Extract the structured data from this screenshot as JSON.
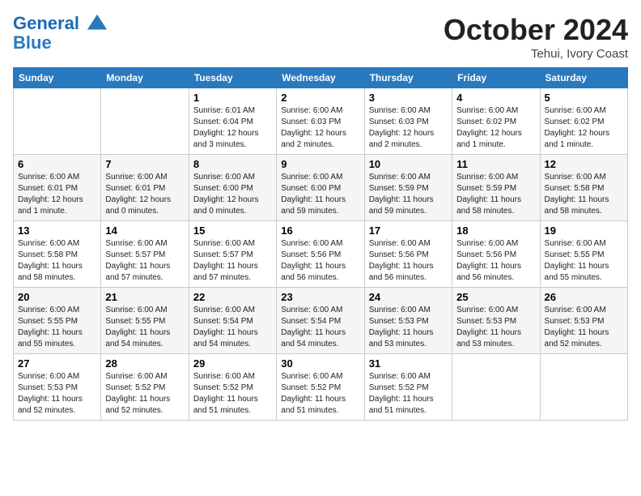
{
  "header": {
    "logo_line1": "General",
    "logo_line2": "Blue",
    "month": "October 2024",
    "location": "Tehui, Ivory Coast"
  },
  "weekdays": [
    "Sunday",
    "Monday",
    "Tuesday",
    "Wednesday",
    "Thursday",
    "Friday",
    "Saturday"
  ],
  "weeks": [
    [
      {
        "day": "",
        "info": ""
      },
      {
        "day": "",
        "info": ""
      },
      {
        "day": "1",
        "info": "Sunrise: 6:01 AM\nSunset: 6:04 PM\nDaylight: 12 hours and 3 minutes."
      },
      {
        "day": "2",
        "info": "Sunrise: 6:00 AM\nSunset: 6:03 PM\nDaylight: 12 hours and 2 minutes."
      },
      {
        "day": "3",
        "info": "Sunrise: 6:00 AM\nSunset: 6:03 PM\nDaylight: 12 hours and 2 minutes."
      },
      {
        "day": "4",
        "info": "Sunrise: 6:00 AM\nSunset: 6:02 PM\nDaylight: 12 hours and 1 minute."
      },
      {
        "day": "5",
        "info": "Sunrise: 6:00 AM\nSunset: 6:02 PM\nDaylight: 12 hours and 1 minute."
      }
    ],
    [
      {
        "day": "6",
        "info": "Sunrise: 6:00 AM\nSunset: 6:01 PM\nDaylight: 12 hours and 1 minute."
      },
      {
        "day": "7",
        "info": "Sunrise: 6:00 AM\nSunset: 6:01 PM\nDaylight: 12 hours and 0 minutes."
      },
      {
        "day": "8",
        "info": "Sunrise: 6:00 AM\nSunset: 6:00 PM\nDaylight: 12 hours and 0 minutes."
      },
      {
        "day": "9",
        "info": "Sunrise: 6:00 AM\nSunset: 6:00 PM\nDaylight: 11 hours and 59 minutes."
      },
      {
        "day": "10",
        "info": "Sunrise: 6:00 AM\nSunset: 5:59 PM\nDaylight: 11 hours and 59 minutes."
      },
      {
        "day": "11",
        "info": "Sunrise: 6:00 AM\nSunset: 5:59 PM\nDaylight: 11 hours and 58 minutes."
      },
      {
        "day": "12",
        "info": "Sunrise: 6:00 AM\nSunset: 5:58 PM\nDaylight: 11 hours and 58 minutes."
      }
    ],
    [
      {
        "day": "13",
        "info": "Sunrise: 6:00 AM\nSunset: 5:58 PM\nDaylight: 11 hours and 58 minutes."
      },
      {
        "day": "14",
        "info": "Sunrise: 6:00 AM\nSunset: 5:57 PM\nDaylight: 11 hours and 57 minutes."
      },
      {
        "day": "15",
        "info": "Sunrise: 6:00 AM\nSunset: 5:57 PM\nDaylight: 11 hours and 57 minutes."
      },
      {
        "day": "16",
        "info": "Sunrise: 6:00 AM\nSunset: 5:56 PM\nDaylight: 11 hours and 56 minutes."
      },
      {
        "day": "17",
        "info": "Sunrise: 6:00 AM\nSunset: 5:56 PM\nDaylight: 11 hours and 56 minutes."
      },
      {
        "day": "18",
        "info": "Sunrise: 6:00 AM\nSunset: 5:56 PM\nDaylight: 11 hours and 56 minutes."
      },
      {
        "day": "19",
        "info": "Sunrise: 6:00 AM\nSunset: 5:55 PM\nDaylight: 11 hours and 55 minutes."
      }
    ],
    [
      {
        "day": "20",
        "info": "Sunrise: 6:00 AM\nSunset: 5:55 PM\nDaylight: 11 hours and 55 minutes."
      },
      {
        "day": "21",
        "info": "Sunrise: 6:00 AM\nSunset: 5:55 PM\nDaylight: 11 hours and 54 minutes."
      },
      {
        "day": "22",
        "info": "Sunrise: 6:00 AM\nSunset: 5:54 PM\nDaylight: 11 hours and 54 minutes."
      },
      {
        "day": "23",
        "info": "Sunrise: 6:00 AM\nSunset: 5:54 PM\nDaylight: 11 hours and 54 minutes."
      },
      {
        "day": "24",
        "info": "Sunrise: 6:00 AM\nSunset: 5:53 PM\nDaylight: 11 hours and 53 minutes."
      },
      {
        "day": "25",
        "info": "Sunrise: 6:00 AM\nSunset: 5:53 PM\nDaylight: 11 hours and 53 minutes."
      },
      {
        "day": "26",
        "info": "Sunrise: 6:00 AM\nSunset: 5:53 PM\nDaylight: 11 hours and 52 minutes."
      }
    ],
    [
      {
        "day": "27",
        "info": "Sunrise: 6:00 AM\nSunset: 5:53 PM\nDaylight: 11 hours and 52 minutes."
      },
      {
        "day": "28",
        "info": "Sunrise: 6:00 AM\nSunset: 5:52 PM\nDaylight: 11 hours and 52 minutes."
      },
      {
        "day": "29",
        "info": "Sunrise: 6:00 AM\nSunset: 5:52 PM\nDaylight: 11 hours and 51 minutes."
      },
      {
        "day": "30",
        "info": "Sunrise: 6:00 AM\nSunset: 5:52 PM\nDaylight: 11 hours and 51 minutes."
      },
      {
        "day": "31",
        "info": "Sunrise: 6:00 AM\nSunset: 5:52 PM\nDaylight: 11 hours and 51 minutes."
      },
      {
        "day": "",
        "info": ""
      },
      {
        "day": "",
        "info": ""
      }
    ]
  ]
}
